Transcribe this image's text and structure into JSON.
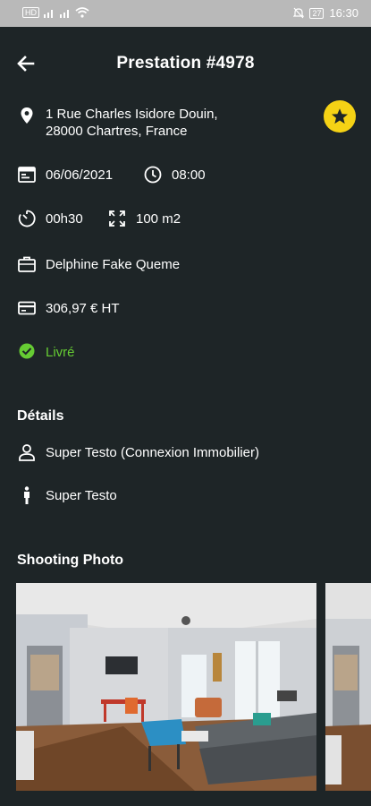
{
  "statusbar": {
    "left_chip": "HD",
    "battery": "27",
    "time": "16:30"
  },
  "header": {
    "title": "Prestation #4978"
  },
  "prestation": {
    "address_line1": "1 Rue Charles Isidore Douin,",
    "address_line2": "28000 Chartres, France",
    "date": "06/06/2021",
    "time": "08:00",
    "duration": "00h30",
    "surface": "100 m2",
    "client": "Delphine Fake Queme",
    "price": "306,97 € HT",
    "status": "Livré"
  },
  "details": {
    "title": "Détails",
    "agency": "Super Testo (Connexion Immobilier)",
    "contact": "Super Testo"
  },
  "shooting": {
    "title": "Shooting Photo"
  },
  "colors": {
    "background": "#1e2527",
    "accent_star": "#f5d215",
    "status_green": "#66cc33",
    "statusbar": "#b9b9b9"
  },
  "icons": {
    "back": "arrow-left-icon",
    "star": "star-icon",
    "location": "location-pin-icon",
    "calendar": "calendar-icon",
    "clock": "clock-icon",
    "timer": "timer-icon",
    "expand": "expand-icon",
    "briefcase": "briefcase-icon",
    "card": "credit-card-icon",
    "check": "check-circle-icon",
    "person": "person-icon",
    "standing-person": "standing-person-icon"
  }
}
